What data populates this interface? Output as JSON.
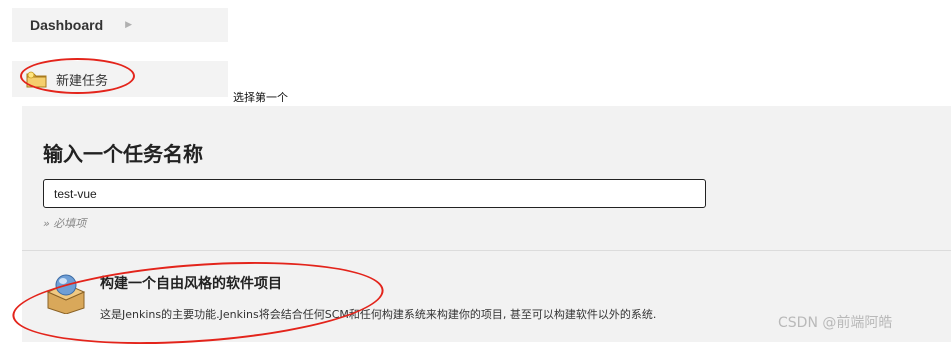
{
  "breadcrumb": {
    "label": "Dashboard",
    "chevron_icon": "chevron-right-icon"
  },
  "sidebar": {
    "new_item": {
      "label": "新建任务",
      "icon": "folder-new-icon"
    }
  },
  "annotation": {
    "text": "选择第一个"
  },
  "form": {
    "title": "输入一个任务名称",
    "name_value": "test-vue",
    "required_note": "» 必填项"
  },
  "option": {
    "icon": "freestyle-project-icon",
    "title": "构建一个自由风格的软件项目",
    "description": "这是Jenkins的主要功能.Jenkins将会结合任何SCM和任何构建系统来构建你的项目, 甚至可以构建软件以外的系统."
  },
  "watermark": {
    "text": "CSDN @前端阿皓"
  },
  "colors": {
    "highlight": "#e3241b",
    "panel_bg": "#f2f2f2"
  }
}
